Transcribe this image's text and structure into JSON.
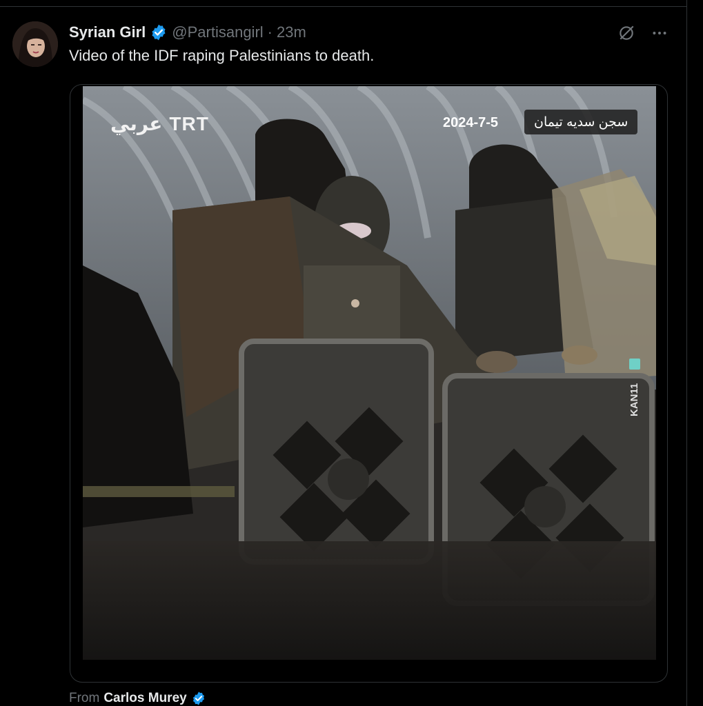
{
  "tweet": {
    "author_name": "Syrian Girl",
    "handle": "@Partisangirl",
    "separator": "·",
    "time": "23m",
    "text": "Video of the IDF raping Palestinians to death."
  },
  "icons": {
    "grok": "grok-icon",
    "more": "more-icon",
    "verified": "verified-badge-icon"
  },
  "video": {
    "logo_arabic": "عربي",
    "logo_latin": "TRT",
    "date": "2024-7-5",
    "caption": "سجن سديه تيمان",
    "watermark": "KAN11"
  },
  "footer": {
    "from_label": "From",
    "source_name": "Carlos Murey"
  },
  "colors": {
    "background": "#000000",
    "text_primary": "#e7e9ea",
    "text_secondary": "#71767b",
    "verified_blue": "#1d9bf0",
    "border": "#2f3336"
  }
}
